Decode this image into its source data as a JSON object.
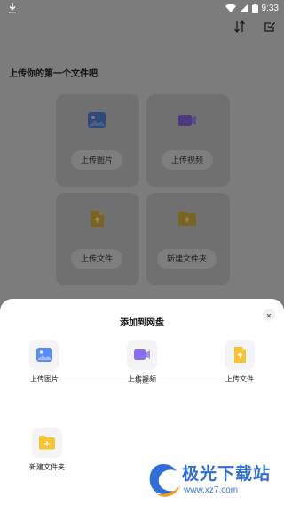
{
  "statusbar": {
    "time": "9:33"
  },
  "main": {
    "heading": "上传你的第一个文件吧",
    "cards": [
      {
        "label": "上传图片"
      },
      {
        "label": "上传视频"
      },
      {
        "label": "上传文件"
      },
      {
        "label": "新建文件夹"
      }
    ]
  },
  "sheet": {
    "title": "添加到网盘",
    "options": [
      {
        "label": "上传图片"
      },
      {
        "label": "上传视频"
      },
      {
        "label": "上传文件"
      }
    ],
    "divider_label": "新建",
    "new_folder_label": "新建文件夹"
  },
  "watermark": {
    "name": "极光下载站",
    "url": "www.xz7.com"
  },
  "colors": {
    "dim_background": "#7c7c7c",
    "sheet": "#ffffff",
    "folder_yellow": "#f5c531",
    "video_purple": "#8a6cf0",
    "image_blue": "#5b8cf5"
  }
}
